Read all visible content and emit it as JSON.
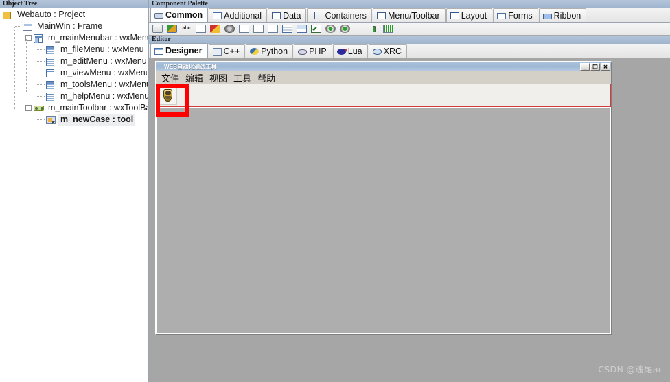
{
  "panels": {
    "object_tree_caption": "Object Tree",
    "component_palette_caption": "Component Palette",
    "editor_caption": "Editor"
  },
  "tree": {
    "nodes": [
      {
        "label": "Webauto : Project",
        "depth": 0,
        "icon": "project-icon",
        "expander": "none",
        "selected": false
      },
      {
        "label": "MainWin : Frame",
        "depth": 1,
        "icon": "frame-icon",
        "expander": "none",
        "selected": false
      },
      {
        "label": "m_mainMenubar : wxMenuBar",
        "depth": 2,
        "icon": "menubar-icon",
        "expander": "minus",
        "selected": false
      },
      {
        "label": "m_fileMenu : wxMenu",
        "depth": 3,
        "icon": "menu-icon",
        "expander": "none",
        "selected": false
      },
      {
        "label": "m_editMenu : wxMenu",
        "depth": 3,
        "icon": "menu-icon",
        "expander": "none",
        "selected": false
      },
      {
        "label": "m_viewMenu : wxMenu",
        "depth": 3,
        "icon": "menu-icon",
        "expander": "none",
        "selected": false
      },
      {
        "label": "m_toolsMenu : wxMenu",
        "depth": 3,
        "icon": "menu-icon",
        "expander": "none",
        "selected": false
      },
      {
        "label": "m_helpMenu : wxMenu",
        "depth": 3,
        "icon": "menu-icon",
        "expander": "none",
        "selected": false
      },
      {
        "label": "m_mainToolbar : wxToolBar",
        "depth": 2,
        "icon": "toolbar-icon",
        "expander": "minus",
        "selected": false
      },
      {
        "label": "m_newCase : tool",
        "depth": 3,
        "icon": "tool-icon",
        "expander": "none",
        "selected": true
      }
    ]
  },
  "palette": {
    "tabs": [
      {
        "label": "Common",
        "icon": "common-icon",
        "active": true
      },
      {
        "label": "Additional",
        "icon": "additional-icon",
        "active": false
      },
      {
        "label": "Data",
        "icon": "data-icon",
        "active": false
      },
      {
        "label": "Containers",
        "icon": "containers-icon",
        "active": false
      },
      {
        "label": "Menu/Toolbar",
        "icon": "menu-toolbar-icon",
        "active": false
      },
      {
        "label": "Layout",
        "icon": "layout-icon",
        "active": false
      },
      {
        "label": "Forms",
        "icon": "forms-icon",
        "active": false
      },
      {
        "label": "Ribbon",
        "icon": "ribbon-icon",
        "active": false
      }
    ],
    "icons": [
      "button-icon",
      "bitmap-button-icon",
      "static-text-icon",
      "text-ctrl-icon",
      "combo-box-icon",
      "choice-icon",
      "spin-ctrl-icon",
      "spin-button-icon",
      "search-ctrl-icon",
      "list-box-icon",
      "list-ctrl-icon",
      "check-box-icon",
      "radio-button-icon",
      "radio-box-icon",
      "static-line-icon",
      "slider-icon",
      "gauge-icon"
    ]
  },
  "editor": {
    "tabs": [
      {
        "label": "Designer",
        "icon": "designer-icon",
        "active": true
      },
      {
        "label": "C++",
        "icon": "cpp-icon",
        "active": false
      },
      {
        "label": "Python",
        "icon": "python-icon",
        "active": false
      },
      {
        "label": "PHP",
        "icon": "php-icon",
        "active": false
      },
      {
        "label": "Lua",
        "icon": "lua-icon",
        "active": false
      },
      {
        "label": "XRC",
        "icon": "xrc-icon",
        "active": false
      }
    ]
  },
  "mock_window": {
    "title": "WEB自动化测试工具",
    "window_buttons": {
      "minimize": "_",
      "maximize": "❐",
      "close": "✕"
    },
    "menu_items": [
      "文件",
      "编辑",
      "视图",
      "工具",
      "帮助"
    ],
    "toolbar": {
      "buttons": [
        {
          "name": "new-case-tool",
          "icon": "shield-icon"
        }
      ],
      "selection_color": "#ff0000"
    }
  },
  "watermark": "CSDN @魂尾ac",
  "colors": {
    "canvas_bg": "#a6a6a6",
    "panel_caption": "#a3b8cf",
    "selection_red": "#ff0000",
    "mock_window_bg": "#d4d0c8"
  }
}
